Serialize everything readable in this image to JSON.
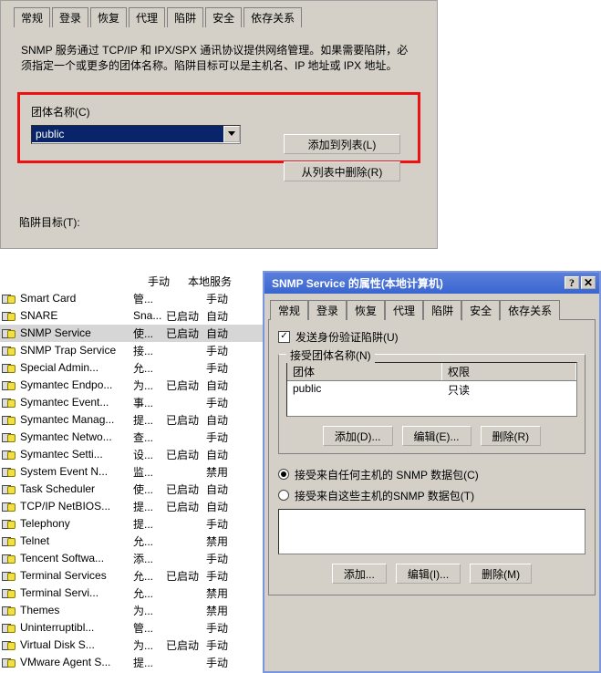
{
  "top": {
    "tabs": [
      "常规",
      "登录",
      "恢复",
      "代理",
      "陷阱",
      "安全",
      "依存关系"
    ],
    "active_tab_index": 4,
    "desc_text": "SNMP 服务通过 TCP/IP 和 IPX/SPX 通讯协议提供网络管理。如果需要陷阱，必须指定一个或更多的团体名称。陷阱目标可以是主机名、IP 地址或 IPX 地址。",
    "community_label": "团体名称(C)",
    "community_value": "public",
    "add_btn": "添加到列表(L)",
    "remove_btn": "从列表中删除(R)",
    "trap_target_label": "陷阱目标(T):"
  },
  "svc_headers": {
    "col_local": "本地服务"
  },
  "svc_list": [
    {
      "name": "Smart Card",
      "desc": "管...",
      "status": "",
      "startup": "手动"
    },
    {
      "name": "SNARE",
      "desc": "Sna...",
      "status": "已启动",
      "startup": "自动"
    },
    {
      "name": "SNMP Service",
      "desc": "使...",
      "status": "已启动",
      "startup": "自动"
    },
    {
      "name": "SNMP Trap Service",
      "desc": "接...",
      "status": "",
      "startup": "手动"
    },
    {
      "name": "Special Admin...",
      "desc": "允...",
      "status": "",
      "startup": "手动"
    },
    {
      "name": "Symantec Endpo...",
      "desc": "为...",
      "status": "已启动",
      "startup": "自动"
    },
    {
      "name": "Symantec Event...",
      "desc": "事...",
      "status": "",
      "startup": "手动"
    },
    {
      "name": "Symantec Manag...",
      "desc": "提...",
      "status": "已启动",
      "startup": "自动"
    },
    {
      "name": "Symantec Netwo...",
      "desc": "查...",
      "status": "",
      "startup": "手动"
    },
    {
      "name": "Symantec Setti...",
      "desc": "设...",
      "status": "已启动",
      "startup": "自动"
    },
    {
      "name": "System Event N...",
      "desc": "监...",
      "status": "",
      "startup": "禁用"
    },
    {
      "name": "Task Scheduler",
      "desc": "使...",
      "status": "已启动",
      "startup": "自动"
    },
    {
      "name": "TCP/IP NetBIOS...",
      "desc": "提...",
      "status": "已启动",
      "startup": "自动"
    },
    {
      "name": "Telephony",
      "desc": "提...",
      "status": "",
      "startup": "手动"
    },
    {
      "name": "Telnet",
      "desc": "允...",
      "status": "",
      "startup": "禁用"
    },
    {
      "name": "Tencent Softwa...",
      "desc": "添...",
      "status": "",
      "startup": "手动"
    },
    {
      "name": "Terminal Services",
      "desc": "允...",
      "status": "已启动",
      "startup": "手动"
    },
    {
      "name": "Terminal Servi...",
      "desc": "允...",
      "status": "",
      "startup": "禁用"
    },
    {
      "name": "Themes",
      "desc": "为...",
      "status": "",
      "startup": "禁用"
    },
    {
      "name": "Uninterruptibl...",
      "desc": "管...",
      "status": "",
      "startup": "手动"
    },
    {
      "name": "Virtual Disk S...",
      "desc": "为...",
      "status": "已启动",
      "startup": "手动"
    },
    {
      "name": "VMware Agent S...",
      "desc": "提...",
      "status": "",
      "startup": "手动"
    }
  ],
  "svc_selected_index": 2,
  "dlg": {
    "title": "SNMP Service 的属性(本地计算机)",
    "tabs": [
      "常规",
      "登录",
      "恢复",
      "代理",
      "陷阱",
      "安全",
      "依存关系"
    ],
    "active_tab_index": 5,
    "send_auth_trap": "发送身份验证陷阱(U)",
    "group_title": "接受团体名称(N)",
    "col_community": "团体",
    "col_permission": "权限",
    "row_community": "public",
    "row_permission": "只读",
    "btn_add": "添加(D)...",
    "btn_edit": "编辑(E)...",
    "btn_delete": "删除(R)",
    "radio_any": "接受来自任何主机的 SNMP 数据包(C)",
    "radio_these": "接受来自这些主机的SNMP 数据包(T)",
    "btn_add2": "添加...",
    "btn_edit2": "编辑(I)...",
    "btn_delete2": "删除(M)"
  }
}
